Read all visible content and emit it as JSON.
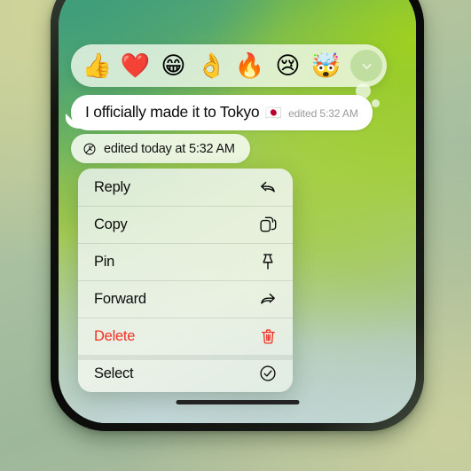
{
  "device": {
    "type": "smartphone",
    "home_indicator": true,
    "bezel_color": "#0a0a0a"
  },
  "wallpaper": {
    "description": "green gradient chat wallpaper",
    "colors": [
      "#45a07f",
      "#6fb45b",
      "#a3ca4e",
      "#b6cdbe",
      "#c3d6d2"
    ]
  },
  "reaction_bar": {
    "reactions": [
      {
        "name": "thumbs-up",
        "glyph": "👍"
      },
      {
        "name": "red-heart",
        "glyph": "❤️"
      },
      {
        "name": "grinning-face-smiling-eyes",
        "glyph": "😁"
      },
      {
        "name": "ok-hand",
        "glyph": "👌"
      },
      {
        "name": "fire",
        "glyph": "🔥"
      },
      {
        "name": "crying-face",
        "glyph": "😢"
      },
      {
        "name": "exploding-head",
        "glyph": "🤯"
      }
    ],
    "more_button": {
      "name": "chevron-down-icon",
      "label": "More reactions"
    }
  },
  "message": {
    "text": "I officially made it to Tokyo",
    "flag": "🇯🇵",
    "meta": "edited 5:32 AM",
    "bubble_color": "#ffffff",
    "incoming": true
  },
  "edited_banner": {
    "icon": "clock-slash-icon",
    "text": "edited today at 5:32 AM"
  },
  "context_menu": {
    "items": [
      {
        "label": "Reply",
        "icon": "reply-arrow-icon",
        "destructive": false,
        "group_break": false
      },
      {
        "label": "Copy",
        "icon": "copy-documents-icon",
        "destructive": false,
        "group_break": false
      },
      {
        "label": "Pin",
        "icon": "pushpin-icon",
        "destructive": false,
        "group_break": false
      },
      {
        "label": "Forward",
        "icon": "forward-arrow-icon",
        "destructive": false,
        "group_break": false
      },
      {
        "label": "Delete",
        "icon": "trash-icon",
        "destructive": true,
        "group_break": false
      },
      {
        "label": "Select",
        "icon": "check-circle-icon",
        "destructive": false,
        "group_break": true
      }
    ],
    "destructive_color": "#f42f24",
    "label_color": "#0c0c0c"
  }
}
